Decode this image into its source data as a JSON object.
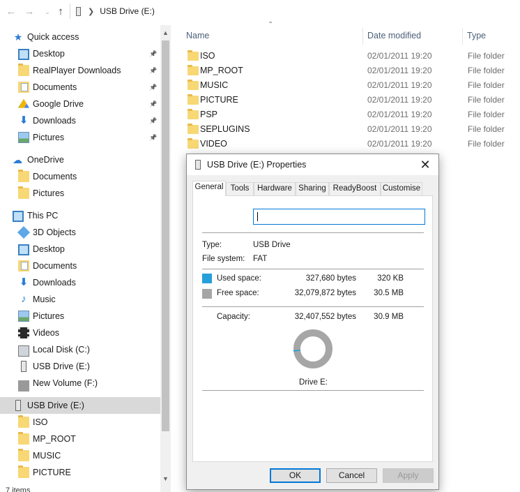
{
  "address": {
    "back_icon": "arrow-left",
    "forward_icon": "arrow-right",
    "up_icon": "arrow-up",
    "location": "USB Drive (E:)"
  },
  "sidebar": {
    "items": [
      {
        "label": "Quick access",
        "icon": "star-icon",
        "pinned": false
      },
      {
        "label": "Desktop",
        "icon": "desktop-icon",
        "pinned": true
      },
      {
        "label": "RealPlayer Downloads",
        "icon": "folder-icon",
        "pinned": true
      },
      {
        "label": "Documents",
        "icon": "documents-icon",
        "pinned": true
      },
      {
        "label": "Google Drive",
        "icon": "google-drive-icon",
        "pinned": true
      },
      {
        "label": "Downloads",
        "icon": "download-icon",
        "pinned": true
      },
      {
        "label": "Pictures",
        "icon": "pictures-icon",
        "pinned": true
      },
      {
        "label": "OneDrive",
        "icon": "cloud-icon",
        "pinned": false
      },
      {
        "label": "Documents",
        "icon": "folder-icon",
        "pinned": false
      },
      {
        "label": "Pictures",
        "icon": "folder-icon",
        "pinned": false
      },
      {
        "label": "This PC",
        "icon": "computer-icon",
        "pinned": false
      },
      {
        "label": "3D Objects",
        "icon": "3d-objects-icon",
        "pinned": false
      },
      {
        "label": "Desktop",
        "icon": "desktop-icon",
        "pinned": false
      },
      {
        "label": "Documents",
        "icon": "documents-icon",
        "pinned": false
      },
      {
        "label": "Downloads",
        "icon": "download-icon",
        "pinned": false
      },
      {
        "label": "Music",
        "icon": "music-icon",
        "pinned": false
      },
      {
        "label": "Pictures",
        "icon": "pictures-icon",
        "pinned": false
      },
      {
        "label": "Videos",
        "icon": "videos-icon",
        "pinned": false
      },
      {
        "label": "Local Disk (C:)",
        "icon": "disk-icon",
        "pinned": false
      },
      {
        "label": "USB Drive (E:)",
        "icon": "usb-drive-icon",
        "pinned": false
      },
      {
        "label": "New Volume (F:)",
        "icon": "drive-icon",
        "pinned": false
      },
      {
        "label": "USB Drive (E:)",
        "icon": "usb-drive-icon",
        "pinned": false,
        "selected": true
      },
      {
        "label": "ISO",
        "icon": "folder-icon",
        "pinned": false
      },
      {
        "label": "MP_ROOT",
        "icon": "folder-icon",
        "pinned": false
      },
      {
        "label": "MUSIC",
        "icon": "folder-icon",
        "pinned": false
      },
      {
        "label": "PICTURE",
        "icon": "folder-icon",
        "pinned": false
      }
    ]
  },
  "columns": {
    "name": "Name",
    "date": "Date modified",
    "type": "Type"
  },
  "files": [
    {
      "name": "ISO",
      "date": "02/01/2011 19:20",
      "type": "File folder"
    },
    {
      "name": "MP_ROOT",
      "date": "02/01/2011 19:20",
      "type": "File folder"
    },
    {
      "name": "MUSIC",
      "date": "02/01/2011 19:20",
      "type": "File folder"
    },
    {
      "name": "PICTURE",
      "date": "02/01/2011 19:20",
      "type": "File folder"
    },
    {
      "name": "PSP",
      "date": "02/01/2011 19:20",
      "type": "File folder"
    },
    {
      "name": "SEPLUGINS",
      "date": "02/01/2011 19:20",
      "type": "File folder"
    },
    {
      "name": "VIDEO",
      "date": "02/01/2011 19:20",
      "type": "File folder"
    }
  ],
  "status_bar": "7 items",
  "dialog": {
    "title": "USB Drive (E:) Properties",
    "tabs": [
      "General",
      "Tools",
      "Hardware",
      "Sharing",
      "ReadyBoost",
      "Customise"
    ],
    "active_tab": "General",
    "name_value": "",
    "type_label": "Type:",
    "type_value": "USB Drive",
    "fs_label": "File system:",
    "fs_value": "FAT",
    "used_label": "Used space:",
    "used_bytes": "327,680 bytes",
    "used_short": "320 KB",
    "free_label": "Free space:",
    "free_bytes": "32,079,872 bytes",
    "free_short": "30.5 MB",
    "capacity_label": "Capacity:",
    "capacity_bytes": "32,407,552 bytes",
    "capacity_short": "30.9 MB",
    "drive_label": "Drive E:",
    "used_fraction": 0.0101,
    "used_color": "#26a0da",
    "free_color": "#a6a6a6",
    "buttons": {
      "ok": "OK",
      "cancel": "Cancel",
      "apply": "Apply"
    }
  }
}
